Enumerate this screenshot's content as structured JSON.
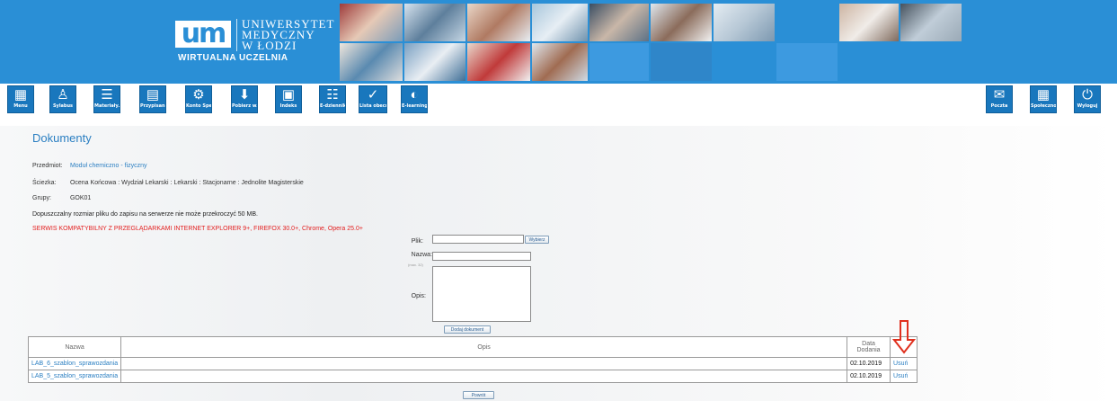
{
  "header": {
    "logo_mark": "um",
    "logo_lines": [
      "UNIWERSYTET",
      "MEDYCZNY",
      "W ŁODZI"
    ],
    "platform_name": "WIRTUALNA UCZELNIA",
    "bg_color": "#2a8fd6"
  },
  "toolbar": {
    "left": [
      {
        "label": "Menu",
        "icon": "grid-icon"
      },
      {
        "label": "Sylabus",
        "icon": "person-doc-icon"
      },
      {
        "label": "Materiały...",
        "icon": "books-icon"
      },
      {
        "label": "Przypisan...",
        "icon": "calendar-icon"
      },
      {
        "label": "Konto Spe...",
        "icon": "user-gear-icon"
      },
      {
        "label": "Pobierz w...",
        "icon": "download-doc-icon"
      },
      {
        "label": "Indeks",
        "icon": "clipboard-icon"
      },
      {
        "label": "E-dziennik",
        "icon": "journal-icon"
      },
      {
        "label": "Lista obecności",
        "icon": "attendance-icon"
      },
      {
        "label": "E-learning",
        "icon": "elearning-icon"
      }
    ],
    "right": [
      {
        "label": "Poczta",
        "icon": "mail-icon"
      },
      {
        "label": "Społeczność",
        "icon": "grid-icon"
      },
      {
        "label": "Wyloguj",
        "icon": "power-icon"
      }
    ]
  },
  "page": {
    "title": "Dokumenty",
    "przedmiot_label": "Przedmiot:",
    "przedmiot_value": "Moduł chemiczno - fizyczny",
    "sciezka_label": "Ściezka:",
    "sciezka_value": "Ocena Końcowa : Wydział Lekarski : Lekarski : Stacjonarne : Jednolite Magisterskie",
    "grupy_label": "Grupy:",
    "grupy_value": "GOK01",
    "size_note": "Dopuszczalny rozmiar pliku do zapisu na serwerze nie może przekroczyć 50 MB.",
    "compat_note": "SERWIS KOMPATYBILNY Z PRZEGLĄDARKAMI INTERNET EXPLORER 9+, FIREFOX 30.0+, Chrome, Opera 25.0+"
  },
  "form": {
    "file_label": "Plik:",
    "browse_label": "Wybierz",
    "name_label": "Nazwa:",
    "limit_hint": "(max. 32)",
    "desc_label": "Opis:",
    "submit_label": "Dodaj dokument"
  },
  "table": {
    "headers": {
      "name": "Nazwa",
      "desc": "Opis",
      "date_line1": "Data",
      "date_line2": "Dodania"
    },
    "rows": [
      {
        "name": "LAB_6_szablon_sprawozdania",
        "desc": "",
        "date": "02.10.2019",
        "action": "Usuń"
      },
      {
        "name": "LAB_5_szablon_sprawozdania",
        "desc": "",
        "date": "02.10.2019",
        "action": "Usuń"
      }
    ]
  },
  "footer": {
    "back_label": "Powrót"
  },
  "colors": {
    "accent": "#2b7fc2",
    "warning": "#e31e1e",
    "arrow": "#e0301e",
    "toolbar_button": "#1977bd"
  }
}
